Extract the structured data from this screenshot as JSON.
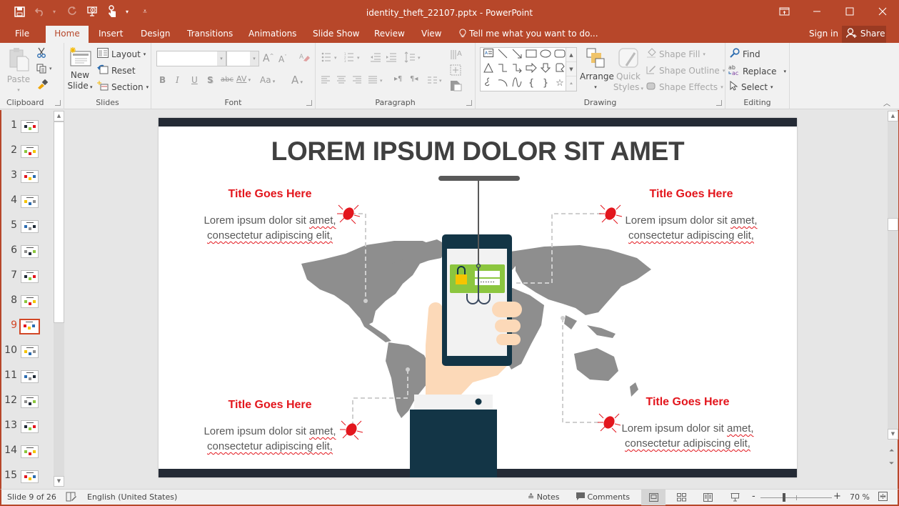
{
  "app": {
    "window_title": "identity_theft_22107.pptx - PowerPoint",
    "accent_color": "#b7472a"
  },
  "qat": {
    "save": "save-icon",
    "undo": "undo-icon",
    "redo": "redo-icon",
    "present": "start-from-beginning-icon",
    "touch": "touch-mode-icon",
    "customize": "customize-qat-icon"
  },
  "window_controls": {
    "restore_ribbon": "ribbon-display-options-icon",
    "minimize": "—",
    "maximize": "☐",
    "close": "✕"
  },
  "tabs": [
    {
      "label": "File",
      "active": false
    },
    {
      "label": "Home",
      "active": true
    },
    {
      "label": "Insert",
      "active": false
    },
    {
      "label": "Design",
      "active": false
    },
    {
      "label": "Transitions",
      "active": false
    },
    {
      "label": "Animations",
      "active": false
    },
    {
      "label": "Slide Show",
      "active": false
    },
    {
      "label": "Review",
      "active": false
    },
    {
      "label": "View",
      "active": false
    }
  ],
  "tell_me": "Tell me what you want to do...",
  "sign_in": "Sign in",
  "share": "Share",
  "ribbon": {
    "clipboard": {
      "label": "Clipboard",
      "paste": "Paste",
      "cut": "cut-icon",
      "copy": "copy-icon",
      "format_painter": "format-painter-icon"
    },
    "slides": {
      "label": "Slides",
      "new_slide_line1": "New",
      "new_slide_line2": "Slide",
      "layout": "Layout",
      "reset": "Reset",
      "section": "Section"
    },
    "font": {
      "label": "Font",
      "font_name": "",
      "font_size": "",
      "bold": "B",
      "italic": "I",
      "underline": "U",
      "shadow": "S",
      "strikethrough": "abc",
      "spacing": "AV",
      "change_case": "Aa",
      "font_color": "A",
      "grow": "A",
      "shrink": "A"
    },
    "paragraph": {
      "label": "Paragraph"
    },
    "drawing": {
      "label": "Drawing",
      "arrange": "Arrange",
      "quick_styles_line1": "Quick",
      "quick_styles_line2": "Styles",
      "shape_fill": "Shape Fill",
      "shape_outline": "Shape Outline",
      "shape_effects": "Shape Effects"
    },
    "editing": {
      "label": "Editing",
      "find": "Find",
      "replace": "Replace",
      "select": "Select"
    }
  },
  "slide_thumbnails": [
    {
      "num": "1"
    },
    {
      "num": "2"
    },
    {
      "num": "3"
    },
    {
      "num": "4"
    },
    {
      "num": "5"
    },
    {
      "num": "6"
    },
    {
      "num": "7"
    },
    {
      "num": "8"
    },
    {
      "num": "9",
      "current": true
    },
    {
      "num": "10"
    },
    {
      "num": "11"
    },
    {
      "num": "12"
    },
    {
      "num": "13"
    },
    {
      "num": "14"
    },
    {
      "num": "15"
    }
  ],
  "slide": {
    "title": "LOREM IPSUM DOLOR SIT AMET",
    "callouts": [
      {
        "title": "Title Goes Here",
        "line1_a": "Lorem ipsum dolor sit ",
        "line1_b": "amet,",
        "line2": "consectetur adipiscing elit,"
      },
      {
        "title": "Title Goes Here",
        "line1_a": "Lorem ipsum dolor sit ",
        "line1_b": "amet,",
        "line2": "consectetur adipiscing elit,"
      },
      {
        "title": "Title Goes Here",
        "line1_a": "Lorem ipsum dolor sit ",
        "line1_b": "amet,",
        "line2": "consectetur adipiscing elit,"
      },
      {
        "title": "Title Goes Here",
        "line1_a": "Lorem ipsum dolor sit ",
        "line1_b": "amet,",
        "line2": "consectetur adipiscing elit,"
      }
    ],
    "colors": {
      "bar": "#242a35",
      "accent_red": "#e3161d",
      "map_gray": "#8e8e8e",
      "phone_navy": "#133546",
      "card_green": "#8cc63f",
      "lock_yellow": "#f5c400",
      "skin": "#fcd9b8"
    }
  },
  "status": {
    "slide_indicator": "Slide 9 of 26",
    "language": "English (United States)",
    "notes": "Notes",
    "comments": "Comments",
    "zoom_level": "70 %",
    "zoom_minus": "-",
    "zoom_plus": "+",
    "zoom_fraction": 0.7
  }
}
